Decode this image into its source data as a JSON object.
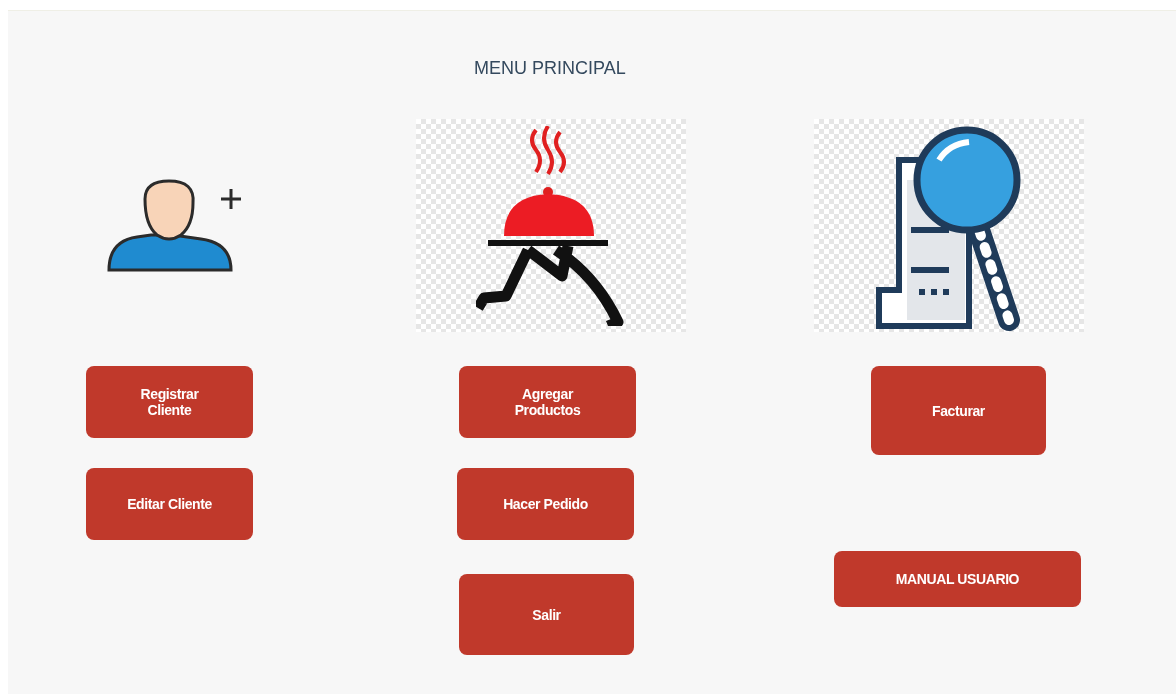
{
  "title": "MENU PRINCIPAL",
  "columns": [
    {
      "kind": "user",
      "buttons": [
        {
          "label": "Registrar Cliente"
        },
        {
          "label": "Editar Cliente"
        }
      ]
    },
    {
      "kind": "delivery",
      "buttons": [
        {
          "label": "Agregar Productos"
        },
        {
          "label": "Hacer Pedido"
        },
        {
          "label": "Salir"
        }
      ]
    },
    {
      "kind": "invoice",
      "buttons": [
        {
          "label": "Facturar"
        },
        {
          "label": "MANUAL USUARIO"
        }
      ]
    }
  ]
}
